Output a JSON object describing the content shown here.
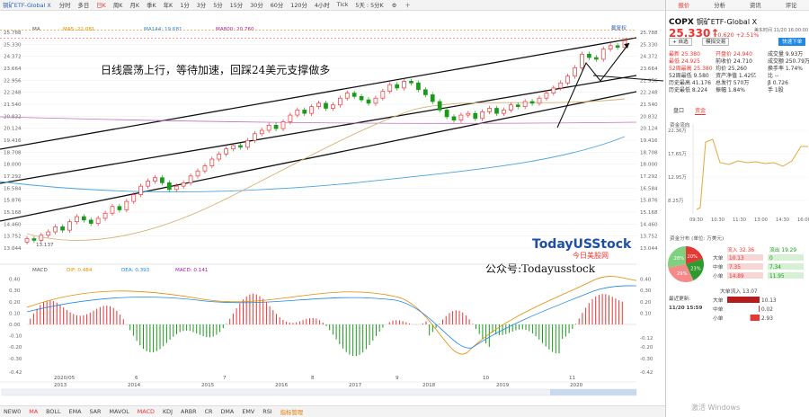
{
  "topbar": {
    "title": "铜矿ETF-Global X",
    "tabs": [
      "分时",
      "多日",
      "日K",
      "周K",
      "月K",
      "季K",
      "年K",
      "1分",
      "3分",
      "5分",
      "15分",
      "30分",
      "60分",
      "120分",
      "4小时",
      "Tick",
      "5天 : 5分K"
    ],
    "active": "日K",
    "icons": [
      "gear-icon",
      "plus-icon"
    ]
  },
  "chart": {
    "ma_legend": {
      "label": "MA",
      "ma5": "MA5: 22.081",
      "ma144": "MA144: 19.681",
      "ma800": "MA800: 20.760"
    },
    "y_labels": [
      "25.788",
      "25.330",
      "24.372",
      "23.664",
      "22.956",
      "22.248",
      "21.540",
      "20.832",
      "20.124",
      "19.416",
      "18.708",
      "18.000",
      "17.292",
      "16.584",
      "15.876",
      "15.168",
      "14.460",
      "13.752",
      "13.044"
    ],
    "min_label": "13.137",
    "max_label": "25.700",
    "badge": "截复权",
    "annotation": "日线震荡上行，等待加速，回踩24美元支撑做多",
    "watermark_en": "TodayUSStock",
    "watermark_cn": "今日美股网",
    "wechat": "公众号:Todayusstock",
    "macd_legend": {
      "label": "MACD",
      "dif": "DIF: 0.484",
      "dea": "DEA: 0.393",
      "macd": "MACD: 0.141"
    },
    "macd_labels": [
      "0.40",
      "0.30",
      "0.20",
      "0.10",
      "0.00",
      "-0.10",
      "-0.20",
      "-0.30",
      "-0.42"
    ],
    "macd_right": [
      "0.40",
      "0.30",
      "0.20",
      "0.10",
      "-0.12",
      "-0.20",
      "-0.30",
      "-0.42"
    ],
    "months": [
      "2020/05",
      "6",
      "7",
      "8",
      "9",
      "10",
      "11"
    ],
    "years": [
      "2013",
      "2014",
      "2015",
      "2016",
      "2017",
      "2018",
      "2019",
      "2020"
    ],
    "price_series": [
      13.6,
      13.5,
      13.8,
      14.0,
      14.3,
      14.1,
      14.6,
      14.9,
      14.7,
      14.5,
      14.8,
      15.1,
      15.5,
      15.3,
      15.8,
      16.2,
      16.7,
      17.0,
      17.2,
      16.9,
      16.5,
      16.7,
      16.9,
      17.3,
      17.6,
      17.9,
      18.3,
      18.6,
      18.9,
      19.1,
      19.0,
      19.4,
      19.8,
      20.0,
      20.3,
      20.1,
      20.5,
      20.9,
      21.2,
      21.0,
      21.4,
      21.6,
      21.3,
      21.5,
      21.9,
      22.2,
      22.0,
      21.8,
      21.6,
      21.9,
      22.3,
      22.7,
      22.5,
      22.9,
      22.8,
      22.4,
      22.1,
      21.7,
      21.2,
      20.8,
      20.6,
      20.9,
      21.0,
      20.7,
      21.1,
      21.3,
      21.0,
      21.2,
      21.5,
      21.4,
      21.7,
      21.6,
      21.9,
      22.2,
      22.5,
      22.8,
      23.2,
      23.7,
      24.5,
      24.3,
      24.2,
      24.8,
      25.0,
      24.9,
      25.3
    ]
  },
  "bottombar": {
    "tabs": [
      "NEW0",
      "MA",
      "BOLL",
      "EMA",
      "SAR",
      "MAVOL",
      "MACD",
      "KDJ",
      "ARBR",
      "CR",
      "DMA",
      "EMV",
      "RSI",
      "指标管理"
    ],
    "active": [
      "MA",
      "MACD"
    ]
  },
  "panel": {
    "tabs": [
      "报价",
      "分析",
      "资讯",
      "评论"
    ],
    "active_tab": "报价",
    "symbol": "COPX",
    "name": "铜矿ETF-Global X",
    "price": "25.330",
    "arrow": "↑",
    "change": "+0.620 +2.51%",
    "time": "美东时间 11/20 16:00:00",
    "buttons": [
      "+ 自选",
      "模拟交易",
      "快速下单"
    ],
    "rows": [
      [
        "最新 25.380",
        "开盘价 24.940",
        "成交量 9.93万"
      ],
      [
        "最低 24.925",
        "前收价 24.710",
        "成交额 250.79万"
      ],
      [
        "52周最高 25.380",
        "均价 25.260",
        "换手率 1.74%"
      ],
      [
        "52周最低 9.580",
        "资产净值 1.42亿",
        "比 --"
      ],
      [
        "历史最高 41.176",
        "总发行 570万",
        "β 0.726"
      ],
      [
        "历史最低 8.224",
        "振幅 1.84%",
        "手 1股"
      ]
    ],
    "subtabs": [
      "盘口",
      "资金"
    ],
    "active_sub": "资金",
    "flow_title": "资金流向",
    "mini_y": [
      "22.36万",
      "17.65万",
      "12.95万",
      "8.25万"
    ],
    "mini_x": [
      "09:30",
      "10:30",
      "11:30",
      "13:00",
      "14:30",
      "16:00"
    ],
    "dist_title": "资金分布 (单位: 万美元)",
    "pie": [
      {
        "label": "20%",
        "value": 20,
        "color": "#e53935"
      },
      {
        "label": "23%",
        "value": 23,
        "color": "#2e9a2e"
      },
      {
        "label": "29%",
        "value": 29,
        "color": "#f48a8a"
      },
      {
        "label": "28%",
        "value": 28,
        "color": "#7fd07f"
      }
    ],
    "inflow": {
      "title": "流入 32.36",
      "rows": [
        [
          "大单",
          "10.13"
        ],
        [
          "中单",
          "7.35"
        ],
        [
          "小单",
          "14.89"
        ]
      ]
    },
    "outflow": {
      "title": "流出 19.29",
      "rows": [
        [
          "0"
        ],
        [
          "7.34"
        ],
        [
          "11.95"
        ]
      ]
    },
    "net": {
      "title": "大单流入 13.07",
      "update": "最近更新:",
      "update_time": "11/20 15:59",
      "rows": [
        [
          "大单",
          "10.13",
          10.13
        ],
        [
          "中单",
          "0.02",
          0.02
        ],
        [
          "小单",
          "2.93",
          2.93
        ]
      ]
    },
    "windows": "激活 Windows"
  }
}
